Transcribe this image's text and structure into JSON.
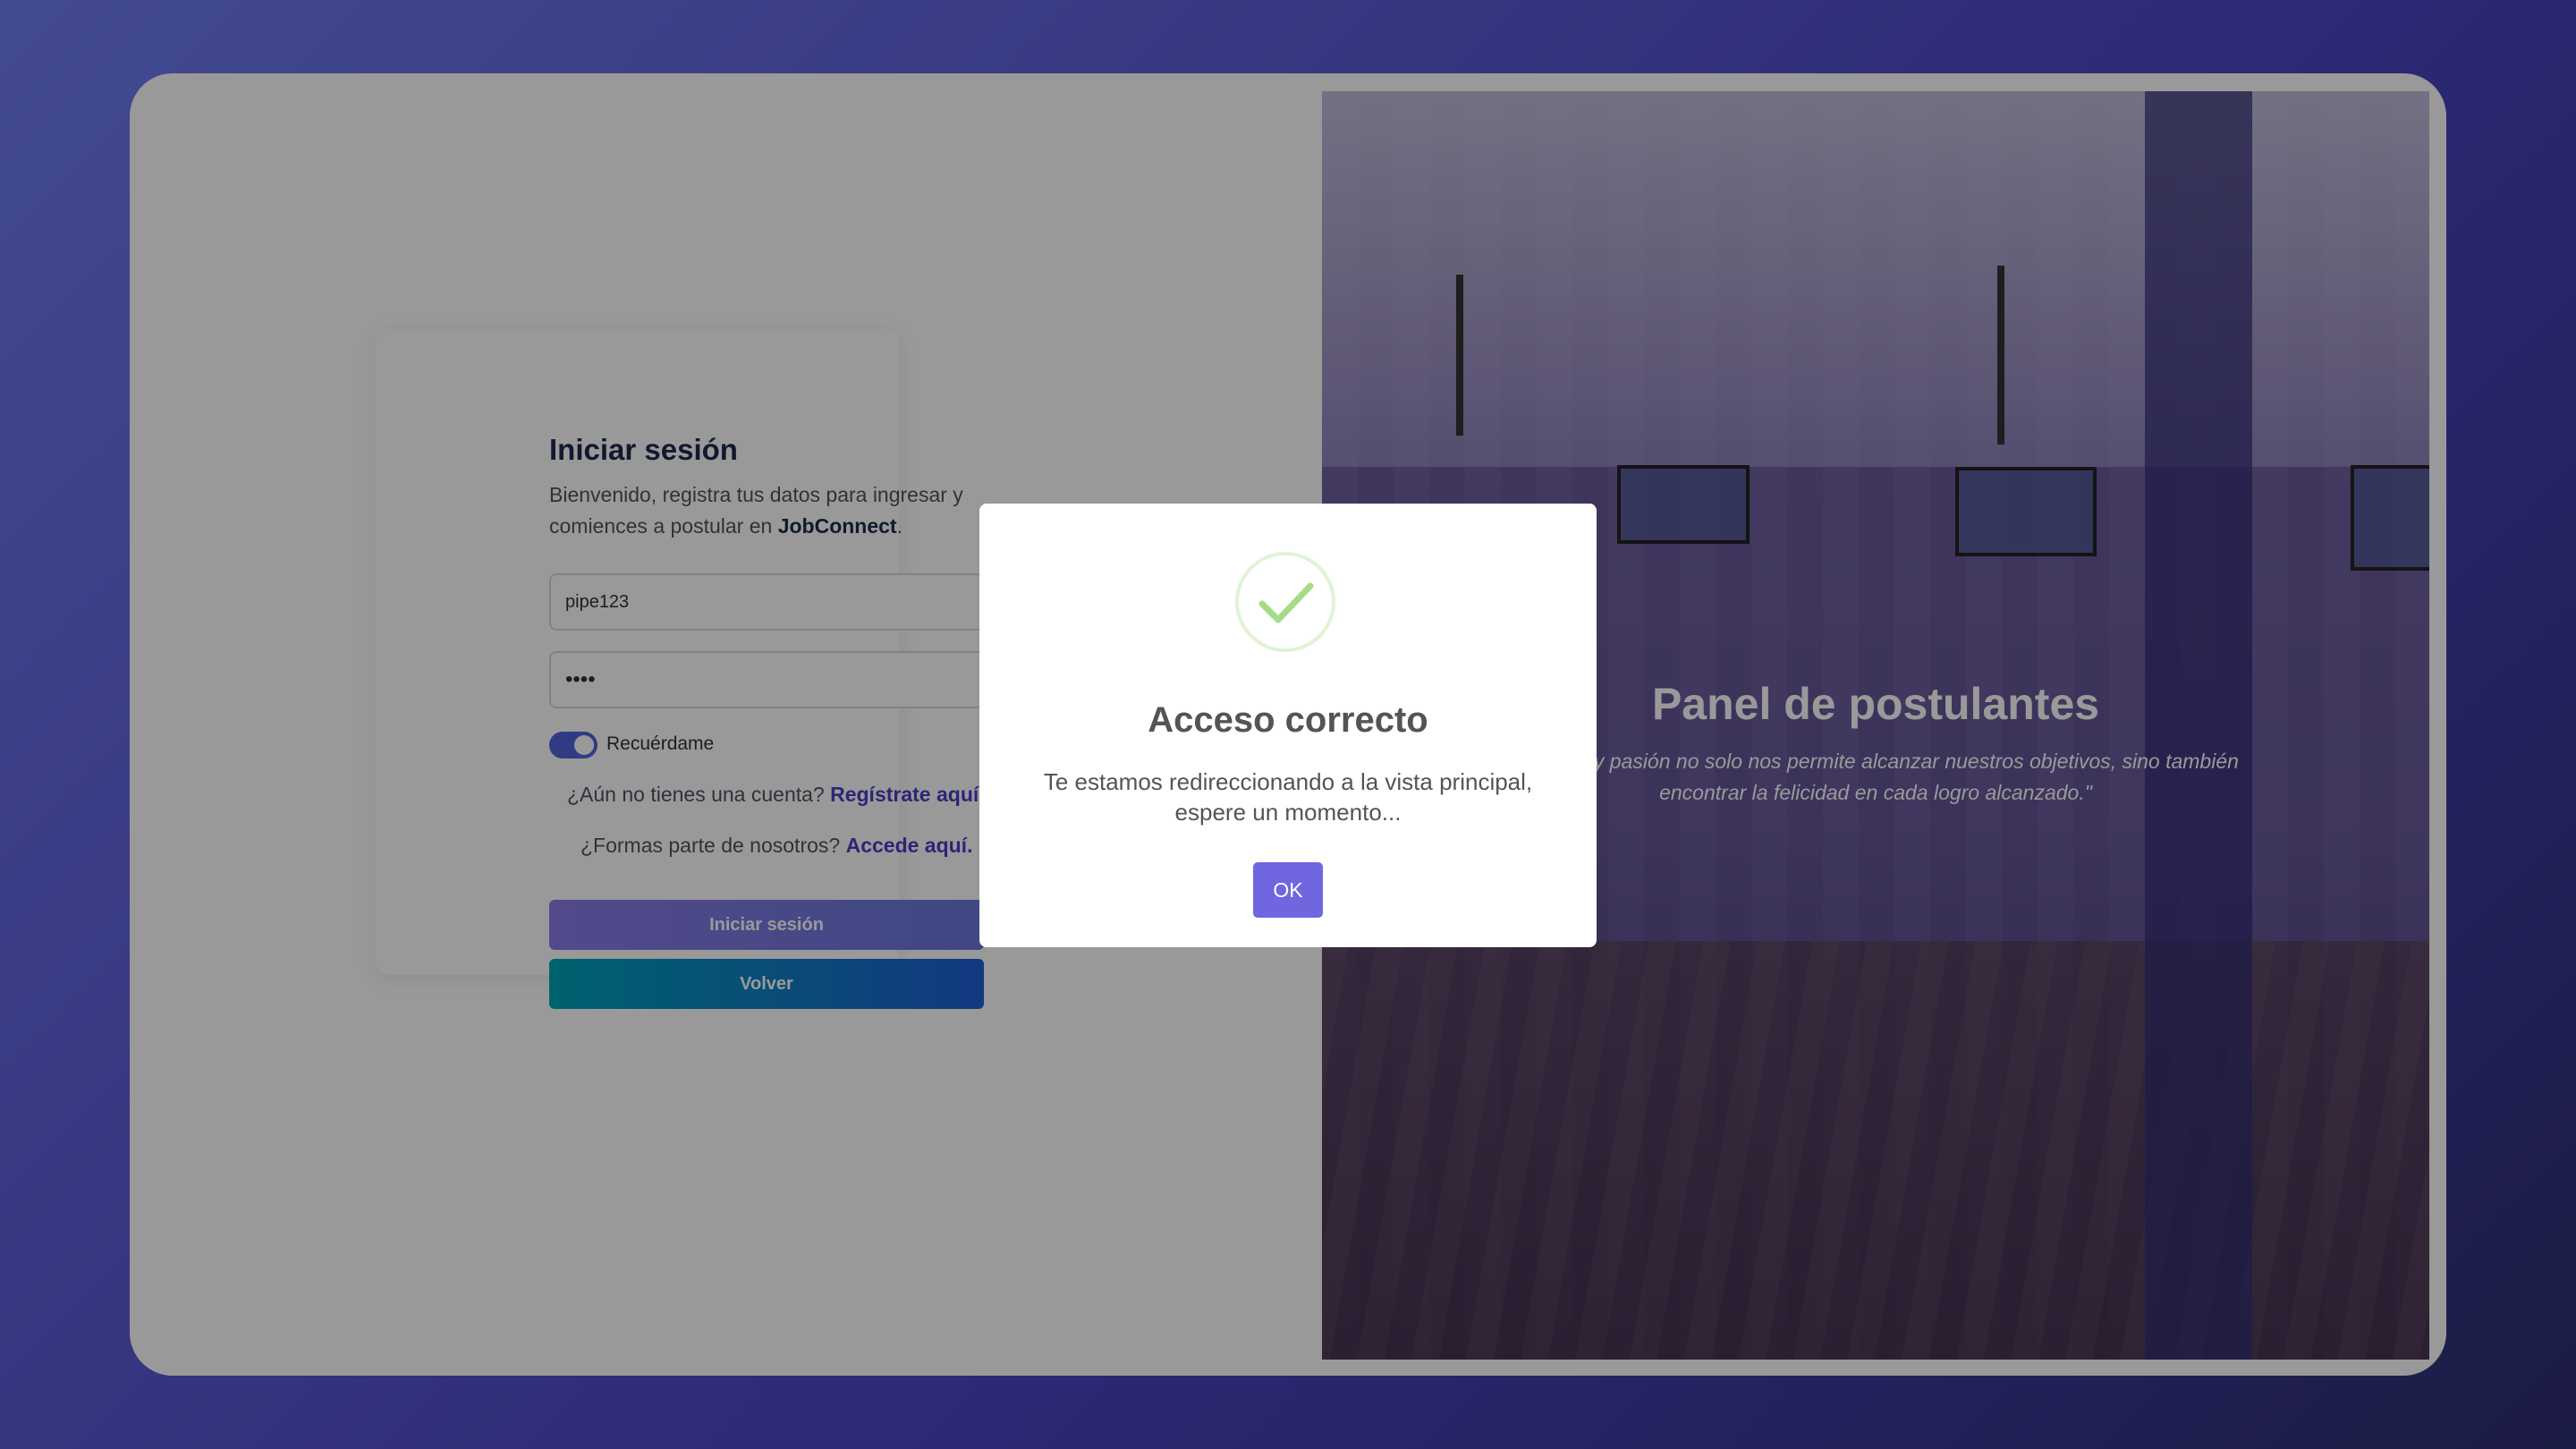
{
  "login": {
    "title": "Iniciar sesión",
    "description_prefix": "Bienvenido, registra tus datos para ingresar y comiences a postular en ",
    "brand": "JobConnect",
    "description_suffix": ".",
    "username_value": "pipe123",
    "password_value": "••••",
    "remember_label": "Recuérdame",
    "remember_checked": true,
    "register_prompt": "¿Aún no tienes una cuenta?",
    "register_link": "Regístrate aquí.",
    "staff_prompt": "¿Formas parte de nosotros?",
    "staff_link": "Accede aquí.",
    "login_button": "Iniciar sesión",
    "back_button": "Volver"
  },
  "hero": {
    "title": "Panel de postulantes",
    "quote_line1": "dicación y pasión no solo nos permite alcanzar nuestros objetivos, sino también",
    "quote_line2": "encontrar la felicidad en cada logro alcanzado.\""
  },
  "modal": {
    "icon": "success-check-icon",
    "title": "Acceso correcto",
    "message": "Te estamos redireccionando a la vista principal, espere un momento...",
    "ok_button": "OK",
    "check_color": "#a5dc86",
    "button_color": "#7066e0"
  }
}
